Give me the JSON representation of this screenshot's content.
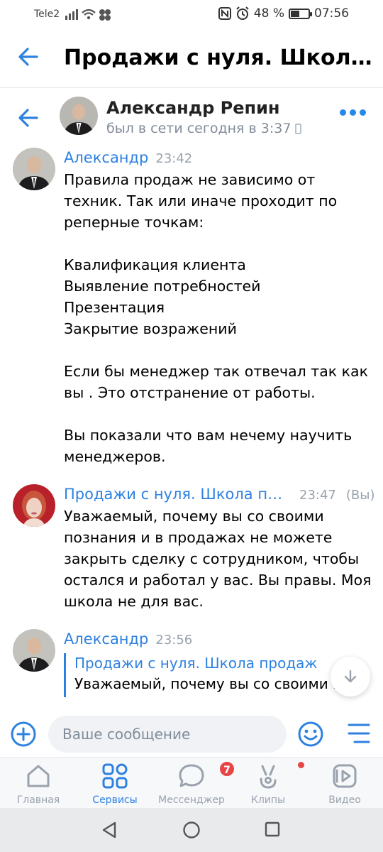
{
  "status_bar": {
    "carrier": "Tele2",
    "battery_text": "48 %",
    "battery_level": 0.48,
    "time": "07:56"
  },
  "top_header": {
    "title": "Продажи с нуля. Школа продаж"
  },
  "chat_header": {
    "name": "Александр Репин",
    "status": "был в сети сегодня в 3:37"
  },
  "messages": [
    {
      "author": "Александр",
      "time": "23:42",
      "text": "Правила продаж не зависимо от техник. Так или иначе проходит по реперные точкам:\n\nКвалификация клиента\nВыявление потребностей\nПрезентация\nЗакрытие возражений\n\nЕсли бы менеджер так отвечал так как вы . Это отстранение от работы.\n\nВы показали что вам нечему научить менеджеров."
    },
    {
      "author": "Продажи с нуля. Школа продаж",
      "time": "23:47",
      "you_label": "(Вы)",
      "text": "Уважаемый, почему вы со своими познания и в продажах не можете закрыть сделку с сотрудником, чтобы остался и работал у вас. Вы правы. Моя школа не для вас."
    },
    {
      "author": "Александр",
      "time": "23:56",
      "reply_author": "Продажи с нуля. Школа продаж",
      "reply_text": "Уважаемый, почему вы со своими п"
    }
  ],
  "composer": {
    "placeholder": "Ваше сообщение"
  },
  "bottom_nav": {
    "items": [
      {
        "label": "Главная",
        "icon": "home-icon"
      },
      {
        "label": "Сервисы",
        "icon": "services-icon",
        "active": true
      },
      {
        "label": "Мессенджер",
        "icon": "messenger-icon",
        "badge": "7"
      },
      {
        "label": "Клипы",
        "icon": "clips-icon"
      },
      {
        "label": "Видео",
        "icon": "video-icon"
      }
    ]
  },
  "colors": {
    "accent": "#2d81e0",
    "badge": "#e64646",
    "muted": "#99a2ad"
  }
}
